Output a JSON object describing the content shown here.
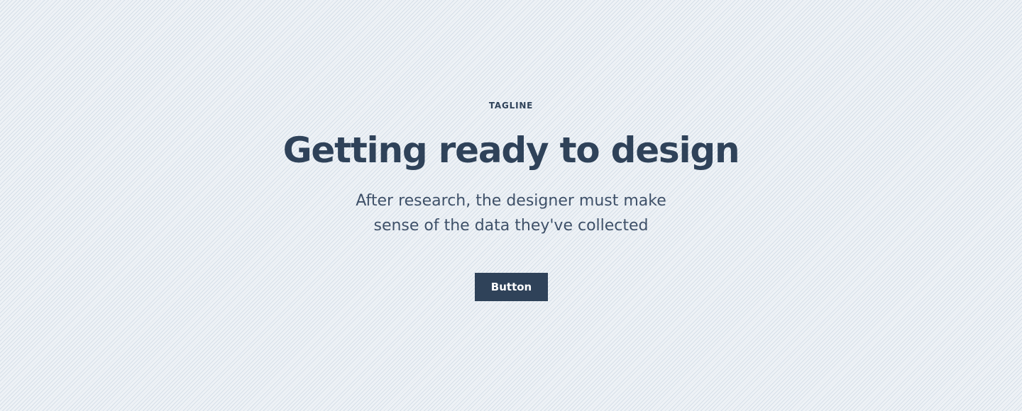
{
  "hero": {
    "tagline": "TAGLINE",
    "title": "Getting ready to design",
    "subtitle": "After research, the designer must make sense of the data they've collected",
    "button_label": "Button"
  },
  "colors": {
    "background": "#eef2f6",
    "stripe": "#c1cfde",
    "text_primary": "#2f4259",
    "text_secondary": "#3e5068",
    "button_background": "#2f4259",
    "button_text": "#ffffff"
  }
}
